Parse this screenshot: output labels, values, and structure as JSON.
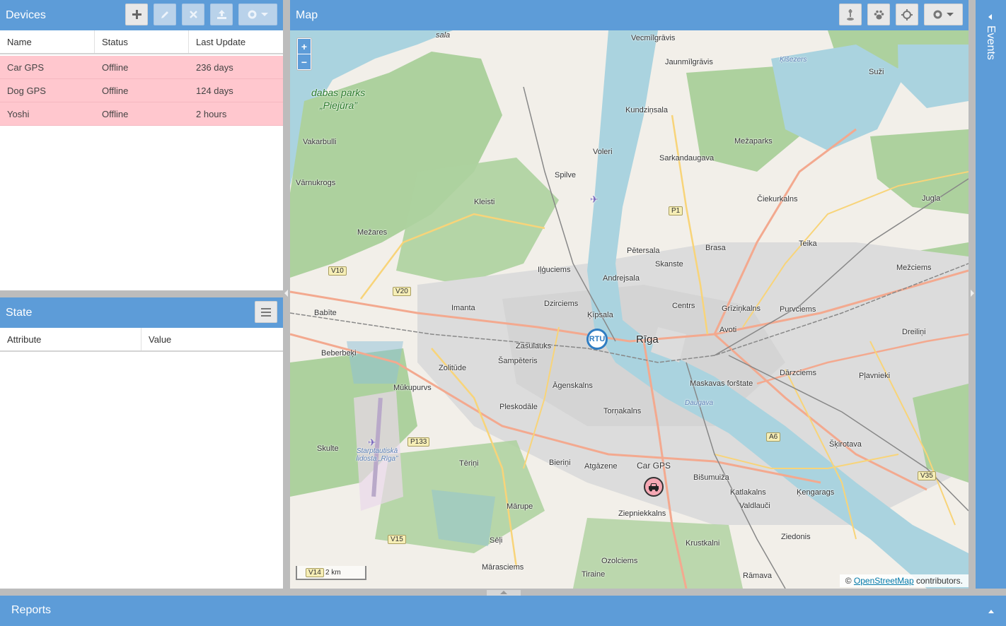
{
  "devices": {
    "title": "Devices",
    "columns": [
      "Name",
      "Status",
      "Last Update"
    ],
    "rows": [
      {
        "name": "Car GPS",
        "status": "Offline",
        "last_update": "236 days"
      },
      {
        "name": "Dog GPS",
        "status": "Offline",
        "last_update": "124 days"
      },
      {
        "name": "Yoshi",
        "status": "Offline",
        "last_update": "2 hours"
      }
    ],
    "row_color": "#ffc7ce"
  },
  "state": {
    "title": "State",
    "columns": [
      "Attribute",
      "Value"
    ]
  },
  "map": {
    "title": "Map",
    "zoom_in": "+",
    "zoom_out": "−",
    "scale_label": "2 km",
    "attribution_prefix": "©",
    "attribution_link": "OpenStreetMap",
    "attribution_suffix": "contributors.",
    "device_marker_label": "Car GPS",
    "labels": {
      "riga": "Rīga",
      "rtu": "RTU",
      "imanta": "Imanta",
      "zasulauks": "Zasulauks",
      "centrs": "Centrs",
      "teika": "Teika",
      "purvciems": "Purvciems",
      "darzciems": "Dārzciems",
      "plavnieki": "Pļavnieki",
      "skirotava": "Šķirotava",
      "kengarags": "Ķengarags",
      "ziepniekkalns": "Ziepniekkalns",
      "bisumuiza": "Bišumuiža",
      "katlakalns": "Katlakalns",
      "agenskalns": "Āgenskalns",
      "tornakalns": "Torņakalns",
      "atgazene": "Atgāzene",
      "bierini": "Bieriņi",
      "pleskodale": "Pleskodāle",
      "zolitude": "Zolitūde",
      "mukupurvs": "Mūkupurvs",
      "beberbeki": "Beberbeķi",
      "babite": "Babīte",
      "dzirciems": "Dzirciems",
      "ilguciems": "Iļģuciems",
      "kleisti": "Kleisti",
      "spilve": "Spilve",
      "voleri": "Voleri",
      "kundzinsala": "Kundziņsala",
      "sarkandaugava": "Sarkandaugava",
      "mezaparks": "Mežaparks",
      "jaunmilgravis": "Jaunmīlgrāvis",
      "vecmilgravis": "Vecmīlgrāvis",
      "ciekurkalns": "Čiekurkalns",
      "brasa": "Brasa",
      "skanste": "Skanste",
      "petersala": "Pētersala",
      "andrejsala": "Andrejsala",
      "kipsala": "Ķīpsala",
      "sampeteris": "Šampēteris",
      "grizinkalns": "Grīziņkalns",
      "avoti": "Avoti",
      "maskavas": "Maskavas forštate",
      "mezciems": "Mežciems",
      "dreilini": "Dreiliņi",
      "jugla": "Jugla",
      "suzi": "Suži",
      "vakarbulli": "Vakarbulli",
      "varnukrogs": "Vārnukrogs",
      "mezares": "Mežares",
      "skulte": "Skulte",
      "terini": "Tēriņi",
      "marupe": "Mārupe",
      "seli": "Sēļi",
      "marasciems": "Mārasciems",
      "zolciems": "Ozolciems",
      "krustkalni": "Krustkalni",
      "valdlauci": "Valdlauči",
      "ziedonis": "Ziedonis",
      "ramava": "Rāmava",
      "tiraine": "Tiraine",
      "dabas_parks": "dabas parks",
      "piejura": "„Piejūra”",
      "daugava": "Daugava",
      "lidosta": "Starptautiskā lidosta „Rīga”",
      "sala": "sala",
      "kiszers": "Ķīšezers"
    },
    "road_badges": [
      "P1",
      "V10",
      "V20",
      "P133",
      "V15",
      "A6",
      "V35",
      "V14"
    ],
    "colors": {
      "land": "#f2efe9",
      "forest": "#add19e",
      "water": "#aad3df",
      "urban": "#dddddd",
      "major_road": "#f3a98f",
      "secondary_road": "#f8d479",
      "rail": "#888888"
    }
  },
  "events": {
    "title": "Events"
  },
  "reports": {
    "title": "Reports"
  },
  "toolbar": {
    "devices_buttons": [
      "add-icon",
      "edit-icon",
      "remove-icon",
      "upload-icon",
      "settings-icon"
    ],
    "map_buttons": [
      "geofence-icon",
      "paw-icon",
      "locate-icon",
      "settings-icon"
    ]
  },
  "theme": {
    "accent": "#5d9cd8",
    "offline_row": "#ffc7ce"
  }
}
